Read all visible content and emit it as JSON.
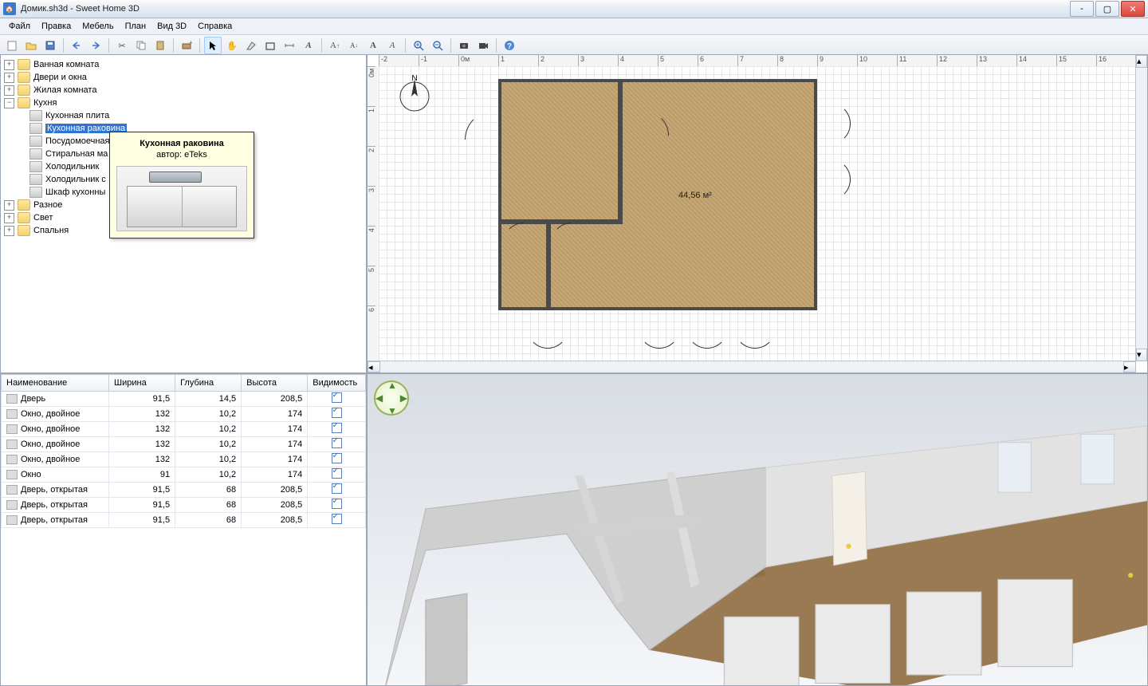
{
  "window": {
    "title": "Домик.sh3d - Sweet Home 3D"
  },
  "menu": [
    "Файл",
    "Правка",
    "Мебель",
    "План",
    "Вид 3D",
    "Справка"
  ],
  "tree": {
    "folders": [
      {
        "label": "Ванная комната",
        "expanded": false
      },
      {
        "label": "Двери и окна",
        "expanded": false
      },
      {
        "label": "Жилая комната",
        "expanded": false
      },
      {
        "label": "Кухня",
        "expanded": true,
        "children": [
          {
            "label": "Кухонная плита"
          },
          {
            "label": "Кухонная раковина",
            "selected": true
          },
          {
            "label": "Посудомоечная"
          },
          {
            "label": "Стиральная ма"
          },
          {
            "label": "Холодильник"
          },
          {
            "label": "Холодильник с"
          },
          {
            "label": "Шкаф кухонны"
          }
        ]
      },
      {
        "label": "Разное",
        "expanded": false
      },
      {
        "label": "Свет",
        "expanded": false
      },
      {
        "label": "Спальня",
        "expanded": false
      }
    ]
  },
  "tooltip": {
    "title": "Кухонная раковина",
    "author": "автор: eTeks"
  },
  "table": {
    "headers": [
      "Наименование",
      "Ширина",
      "Глубина",
      "Высота",
      "Видимость"
    ],
    "rows": [
      {
        "name": "Дверь",
        "w": "91,5",
        "d": "14,5",
        "h": "208,5",
        "v": true
      },
      {
        "name": "Окно, двойное",
        "w": "132",
        "d": "10,2",
        "h": "174",
        "v": true
      },
      {
        "name": "Окно, двойное",
        "w": "132",
        "d": "10,2",
        "h": "174",
        "v": true
      },
      {
        "name": "Окно, двойное",
        "w": "132",
        "d": "10,2",
        "h": "174",
        "v": true
      },
      {
        "name": "Окно, двойное",
        "w": "132",
        "d": "10,2",
        "h": "174",
        "v": true
      },
      {
        "name": "Окно",
        "w": "91",
        "d": "10,2",
        "h": "174",
        "v": true
      },
      {
        "name": "Дверь, открытая",
        "w": "91,5",
        "d": "68",
        "h": "208,5",
        "v": true
      },
      {
        "name": "Дверь, открытая",
        "w": "91,5",
        "d": "68",
        "h": "208,5",
        "v": true
      },
      {
        "name": "Дверь, открытая",
        "w": "91,5",
        "d": "68",
        "h": "208,5",
        "v": true
      }
    ]
  },
  "plan": {
    "room_area": "44,56 м²",
    "ruler_h": [
      "-2",
      "-1",
      "0м",
      "1",
      "2",
      "3",
      "4",
      "5",
      "6",
      "7",
      "8",
      "9",
      "10",
      "11",
      "12",
      "13",
      "14",
      "15",
      "16"
    ],
    "ruler_v": [
      "0м",
      "1",
      "2",
      "3",
      "4",
      "5",
      "6"
    ],
    "compass": "N"
  }
}
